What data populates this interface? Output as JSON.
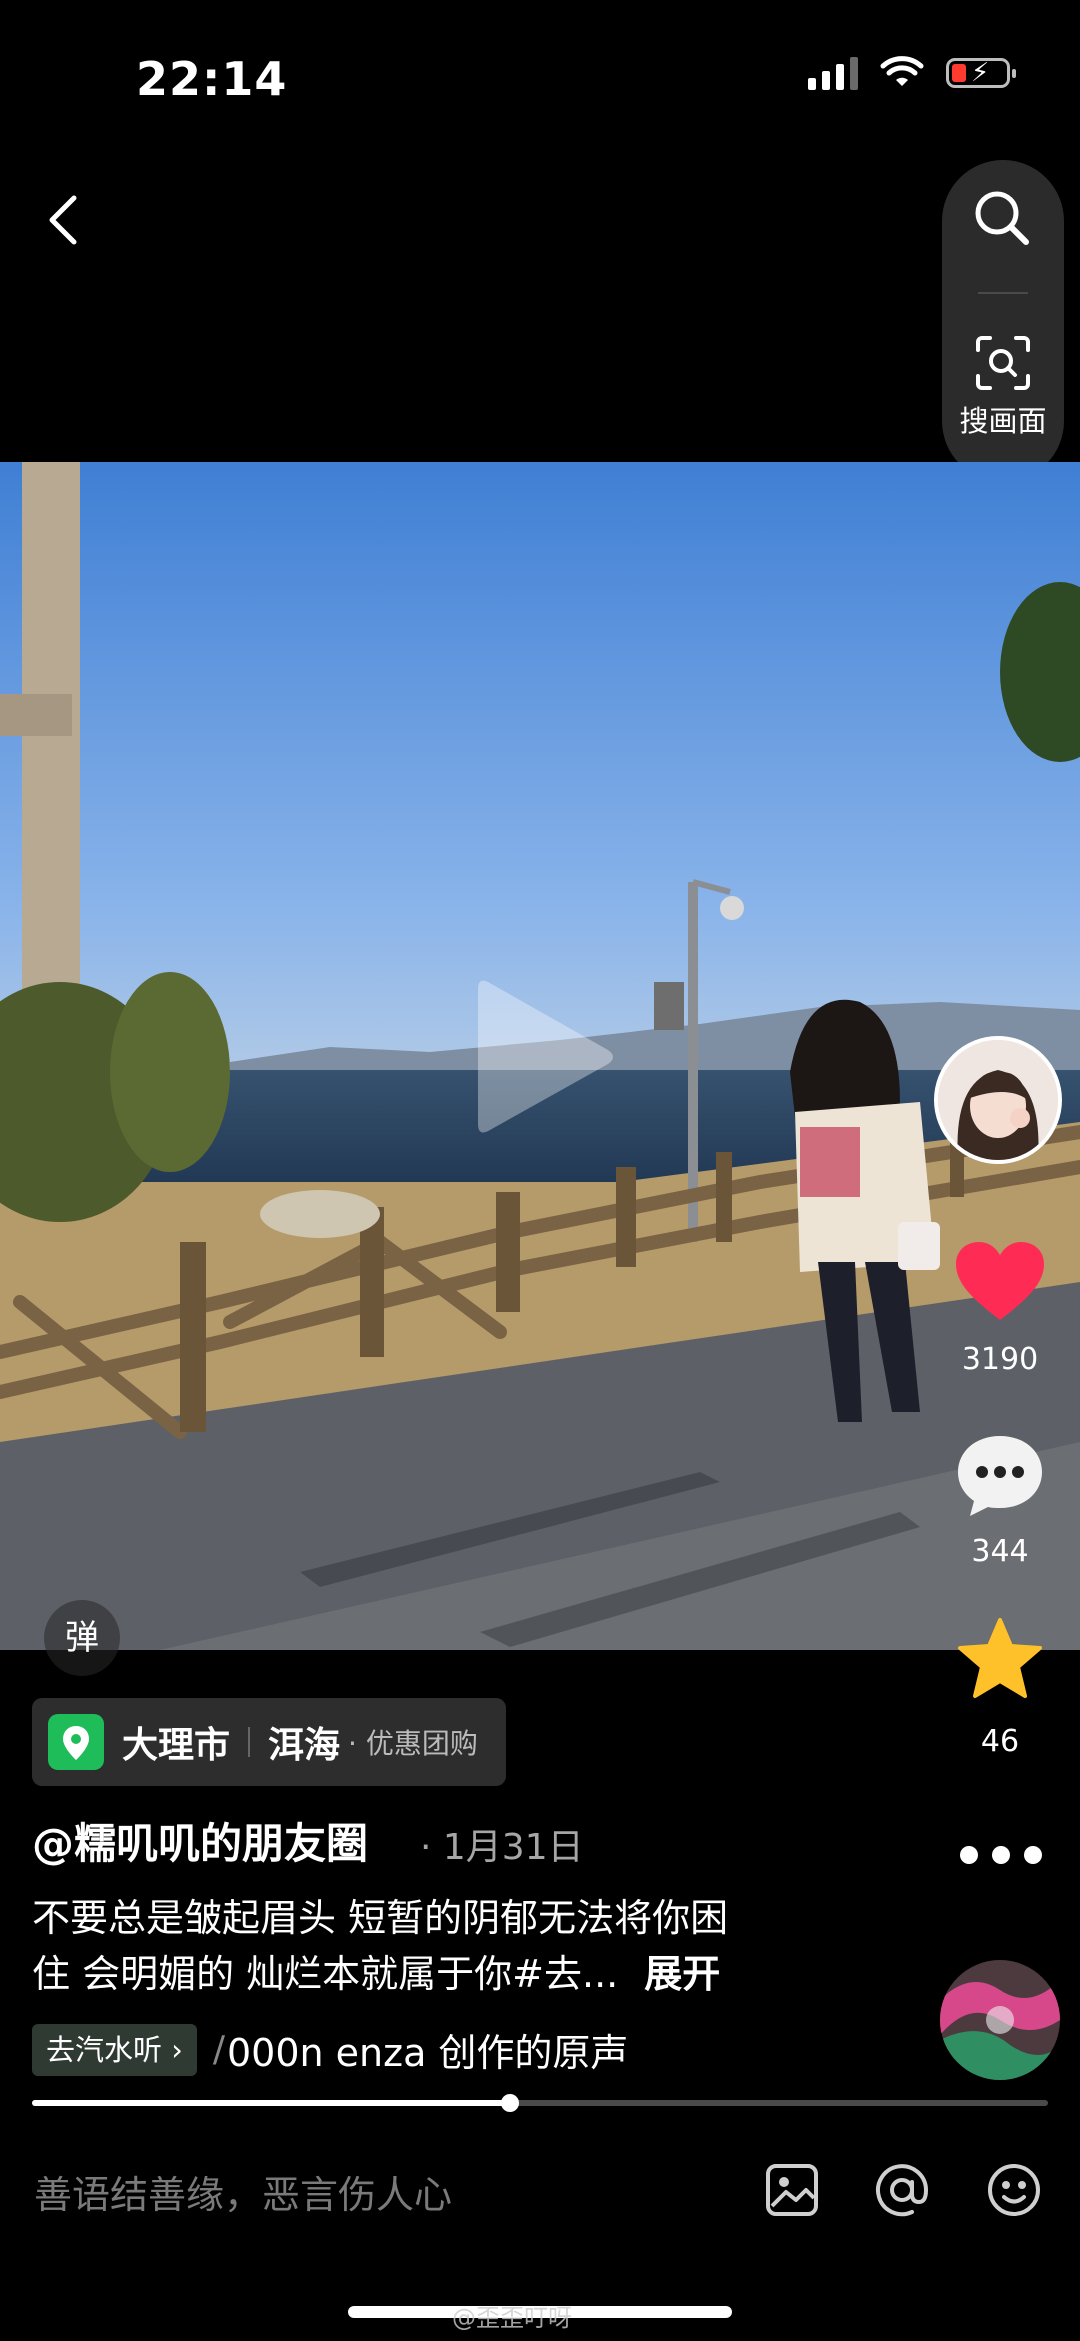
{
  "status_bar": {
    "time": "22:14",
    "battery_level": 0.15,
    "charging": true,
    "signal_bars": "3/4"
  },
  "top": {
    "back_icon": "chevron-left-icon",
    "search_icon": "search-icon",
    "scan_label": "搜画面"
  },
  "video": {
    "playing": false,
    "danmaku_label": "弹"
  },
  "rail": {
    "like_count": "3190",
    "comment_count": "344",
    "favorite_count": "46",
    "like_color": "#fe2c55",
    "star_color": "#ffc12a"
  },
  "location": {
    "city": "大理市",
    "place": "洱海",
    "deal": "· 优惠团购",
    "pin_color": "#1fbd5a"
  },
  "post": {
    "author": "@糯叽叽的朋友圈",
    "date": "· 1月31日",
    "desc_line1": "不要总是皱起眉头 短暂的阴郁无法将你困",
    "desc_line2": "住 会明媚的 灿烂本就属于你#去...",
    "expand": "展开"
  },
  "music": {
    "tag": "去汽水听 ›",
    "title": "000n enza 创作的原声"
  },
  "progress": {
    "fraction": 0.47
  },
  "comment_bar": {
    "placeholder": "善语结善缘，恶言伤人心"
  },
  "watermark": "@歪歪叮呀"
}
